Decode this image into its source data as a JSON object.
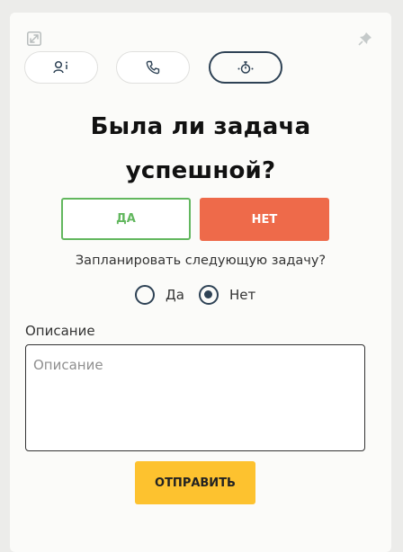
{
  "toolbar": {
    "expand_icon": "expand-icon",
    "pin_icon": "pin-icon"
  },
  "tabs": [
    {
      "icon": "user-info-icon",
      "active": false
    },
    {
      "icon": "phone-icon",
      "active": false
    },
    {
      "icon": "timer-icon",
      "active": true
    }
  ],
  "question": {
    "line1": "Была ли задача",
    "line2": "успешной?"
  },
  "answer": {
    "yes_label": "ДА",
    "no_label": "НЕТ"
  },
  "schedule": {
    "label": "Запланировать следующую задачу?",
    "options": [
      {
        "label": "Да",
        "checked": false
      },
      {
        "label": "Нет",
        "checked": true
      }
    ]
  },
  "description": {
    "label": "Описание",
    "placeholder": "Описание",
    "value": ""
  },
  "submit_label": "ОТПРАВИТЬ",
  "colors": {
    "accent_dark": "#2e4255",
    "yes_green": "#62b75e",
    "no_red": "#ee6a4a",
    "submit_yellow": "#fdc22f"
  }
}
